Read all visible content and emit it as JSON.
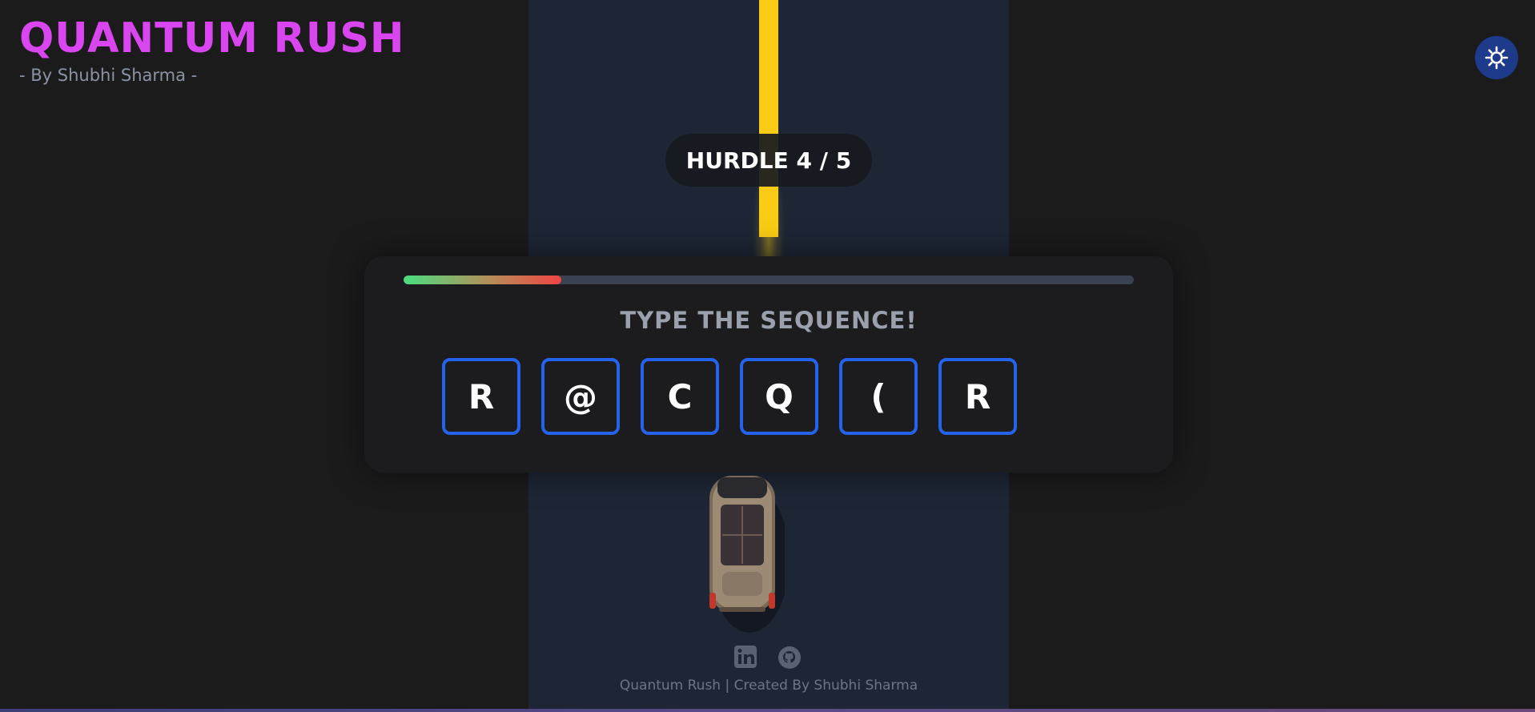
{
  "header": {
    "title": "QUANTUM RUSH",
    "subtitle": "- By Shubhi Sharma -"
  },
  "theme_toggle": {
    "icon": "sun-icon"
  },
  "hud": {
    "hurdle_label": "HURDLE 4 / 5",
    "hurdle_current": 4,
    "hurdle_total": 5
  },
  "challenge": {
    "timer_fraction": 0.216,
    "prompt": "TYPE THE SEQUENCE!",
    "sequence": [
      "R",
      "@",
      "C",
      "Q",
      "(",
      "R"
    ]
  },
  "footer": {
    "icons": [
      "linkedin-icon",
      "github-icon"
    ],
    "credit": "Quantum Rush | Created By Shubhi Sharma"
  },
  "colors": {
    "title": "#d946ef",
    "road": "#1e2635",
    "lane_line": "#facc15",
    "key_border": "#2563eb",
    "theme_button": "#1e3a8a"
  }
}
